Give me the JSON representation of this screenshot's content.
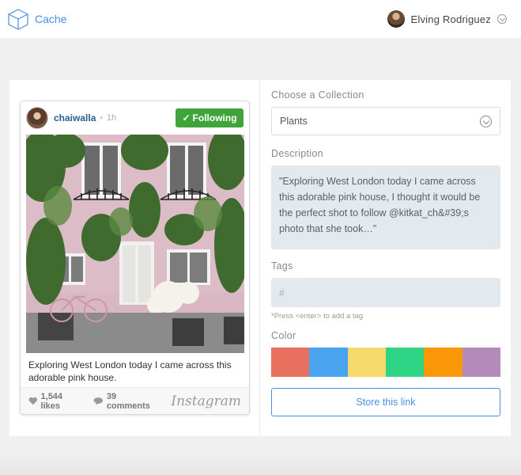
{
  "header": {
    "brand": "Cache",
    "user_name": "Elving Rodriguez"
  },
  "post": {
    "username": "chaiwalla",
    "time": "1h",
    "follow_label": "Following",
    "caption": "Exploring West London today I came across this adorable pink house.",
    "likes": "1,544 likes",
    "comments": "39 comments",
    "platform": "Instagram"
  },
  "form": {
    "collection_label": "Choose a Collection",
    "collection_value": "Plants",
    "description_label": "Description",
    "description_value": "\"Exploring West London today I came across this adorable pink house, I thought it would be the perfect shot to follow @kitkat_ch&#39;s photo that she took…\"",
    "tags_label": "Tags",
    "tags_placeholder": "#",
    "tags_hint": "*Press <enter> to add a tag",
    "color_label": "Color",
    "colors": [
      "#e8705f",
      "#4aa3ef",
      "#f6d96b",
      "#2fd584",
      "#fa9706",
      "#b28bb8"
    ],
    "store_label": "Store this link"
  },
  "icons": {
    "brand": "cube-icon",
    "dropdown": "chevron-down-icon",
    "follow": "check-icon",
    "like": "heart-icon",
    "comment": "speech-bubble-icon"
  }
}
